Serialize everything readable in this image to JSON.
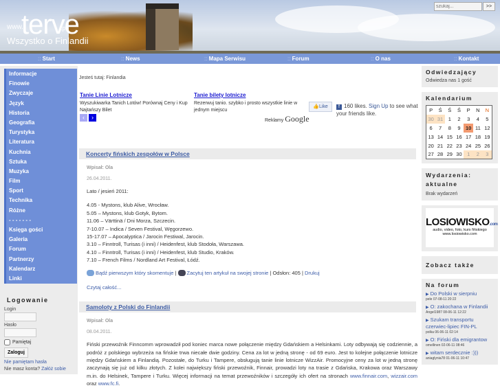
{
  "header": {
    "logo_www": "www.",
    "logo_name": "terve",
    "logo_tld": ".pl",
    "subtitle": "Wszystko o Finlandii",
    "search_placeholder": "szukaj...",
    "search_button": ">>"
  },
  "nav": [
    {
      "sep": ":: ",
      "label": "Start"
    },
    {
      "sep": ":: ",
      "label": "News"
    },
    {
      "sep": ":: ",
      "label": "Mapa Serwisu"
    },
    {
      "sep": ":: ",
      "label": "Forum"
    },
    {
      "sep": ":: ",
      "label": "O nas"
    },
    {
      "sep": ":: ",
      "label": "Kontakt"
    }
  ],
  "menu": [
    "Informacje",
    "Finowie",
    "Zwyczaje",
    "Język",
    "Historia",
    "Geografia",
    "Turystyka",
    "Literatura",
    "Kuchnia",
    "Sztuka",
    "Muzyka",
    "Film",
    "Sport",
    "Technika",
    "Różne",
    "- - - - - - -",
    "Księga gości",
    "Galeria",
    "Forum",
    "Partnerzy",
    "Kalendarz",
    "Linki"
  ],
  "login": {
    "title": "Logowanie",
    "login_label": "Login",
    "password_label": "Hasło",
    "remember": "Pamiętaj",
    "submit": "Zaloguj",
    "forgot": "Nie pamiętam hasła",
    "no_account": "Nie masz konta?",
    "register": "Załóż sobie"
  },
  "breadcrumb": "Jesteś tutaj: Finlandia",
  "ads": [
    {
      "title": "Tanie Linie Lotnicze",
      "text": "Wyszukiwarka Tanich Lotów! Porównaj Ceny i Kup Najtańszy Bilet"
    },
    {
      "title": "Tanie bilety lotnicze",
      "text": "Rezerwuj tanio. szybko i prosto wszystkie linie w jednym miejscu"
    }
  ],
  "ads_prev": "‹",
  "ads_next": "›",
  "ads_label": "Reklamy",
  "ads_brand": "Google",
  "facebook": {
    "like": "Like",
    "count": "160 likes.",
    "signup": "Sign Up",
    "rest": "to see what your friends like."
  },
  "articles": [
    {
      "title": "Koncerty fińskich zespołów w Polsce",
      "author": "Wpisał: Ola",
      "date": "26.04.2011.",
      "intro": "Lato / jesień 2011:",
      "lines": [
        "4.05 - Mystons, klub Alive, Wrocław.",
        "5.05 – Mystons, klub Gotyk, Bytom.",
        "11.06 – Värttinä / Dni Morza, Szczecin.",
        "7-10.07 – Indica / Seven Festival, Węgorzewo.",
        "15-17.07 – Apocalyptica / Jarocin Festiwal, Jarocin.",
        "3.10 – Finntroll, Turisas (i inni) / Heidenfest, klub Stodoła, Warszawa.",
        "4.10 – Finntroll, Turisas (i inni) / Heidenfest, klub Studio, Kraków.",
        "7.10 – French Films / Nordland Art Festival, Łódź."
      ],
      "comment": "Bądź pierwszym który skomentuje",
      "cite": "Zacytuj ten artykuł na swojej stronie",
      "views": "| Odsłon: 405 |",
      "print": "Drukuj",
      "more": "Czytaj całość..."
    },
    {
      "title": "Samoloty z Polski do Finlandii",
      "author": "Wpisał: Ola",
      "date": "08.04.2011.",
      "text": "Fiński przewoźnik Finncomm wprowadził pod koniec marca nowe połączenie między Gdańskiem a Helsinkami. Loty odbywają się codziennie, a podróż z polskiego wybrzeża na fińskie trwa niecałe dwie godziny. Cena za lot w jedną stronę - od 69 euro. Jest to kolejne połączenie lotnicze między Gdańskiem a Finlandią. Pozostałe, do Turku i Tampere, obsługują tanie linie lotnicze WizzAir. Promocyjne ceny za lot w jedną stronę zaczynają się już od kilku złotych. Z kolei największy fiński przewoźnik, Finnair, prowadzi loty na trasie z Gdańska, Krakowa oraz Warszawy m.in. do Helsinek, Tampere i Turku. Więcej informacji na temat przewoźników i szczegóły ich ofert na stronach",
      "link1": "www.finnair.com",
      "sep1": ", ",
      "link2": "wizzair.com",
      "sep2": " oraz ",
      "link3": "www.fc.fi",
      "end": "."
    }
  ],
  "visitors": {
    "title": "Odwiedzający",
    "text": "Odwiedza nas 1 gość"
  },
  "calendar": {
    "title": "Kalendarium",
    "days": [
      "P",
      "Ś",
      "Ś",
      "Ś",
      "P",
      "N",
      "N"
    ],
    "weeks": [
      [
        "30",
        "31",
        "1",
        "2",
        "3",
        "4",
        "5"
      ],
      [
        "6",
        "7",
        "8",
        "9",
        "10",
        "11",
        "12"
      ],
      [
        "13",
        "14",
        "15",
        "16",
        "17",
        "18",
        "19"
      ],
      [
        "20",
        "21",
        "22",
        "23",
        "24",
        "25",
        "26"
      ],
      [
        "27",
        "28",
        "29",
        "30",
        "1",
        "2",
        "3"
      ]
    ],
    "today": "10"
  },
  "events": {
    "title": "Wydarzenia: aktualne",
    "text": "Brak wydarzeń"
  },
  "banner": {
    "name": "LOSIOWISKO",
    "domain": ".com",
    "tagline": "audio, video, foto, kurs fińskiego",
    "url": "www.losiowisko.com"
  },
  "see_also": {
    "title": "Zobacz także"
  },
  "forum": {
    "title": "Na forum",
    "items": [
      {
        "title": "Do Polski w sierpniu",
        "meta": "pele 07-08-11 20:22"
      },
      {
        "title": "O: zakochana w Finlandii",
        "meta": "Angel1987 08-06-11 12:22"
      },
      {
        "title": "Szukam transportu czerwiec-lipiec FIN-PL",
        "meta": "polka 06-06-11 02:14"
      },
      {
        "title": "O: Fiński dla emigrantow",
        "meta": "omellinen 02-06-11 08:46"
      },
      {
        "title": "witam serdecznie :)))",
        "meta": "aniaglynia78 01-06-11 10:47"
      }
    ]
  },
  "colors": {
    "nav": "#7a98d8",
    "menu": "#6f8fd8",
    "link": "#3c5ca8",
    "ad_link": "#1a1ad0"
  }
}
